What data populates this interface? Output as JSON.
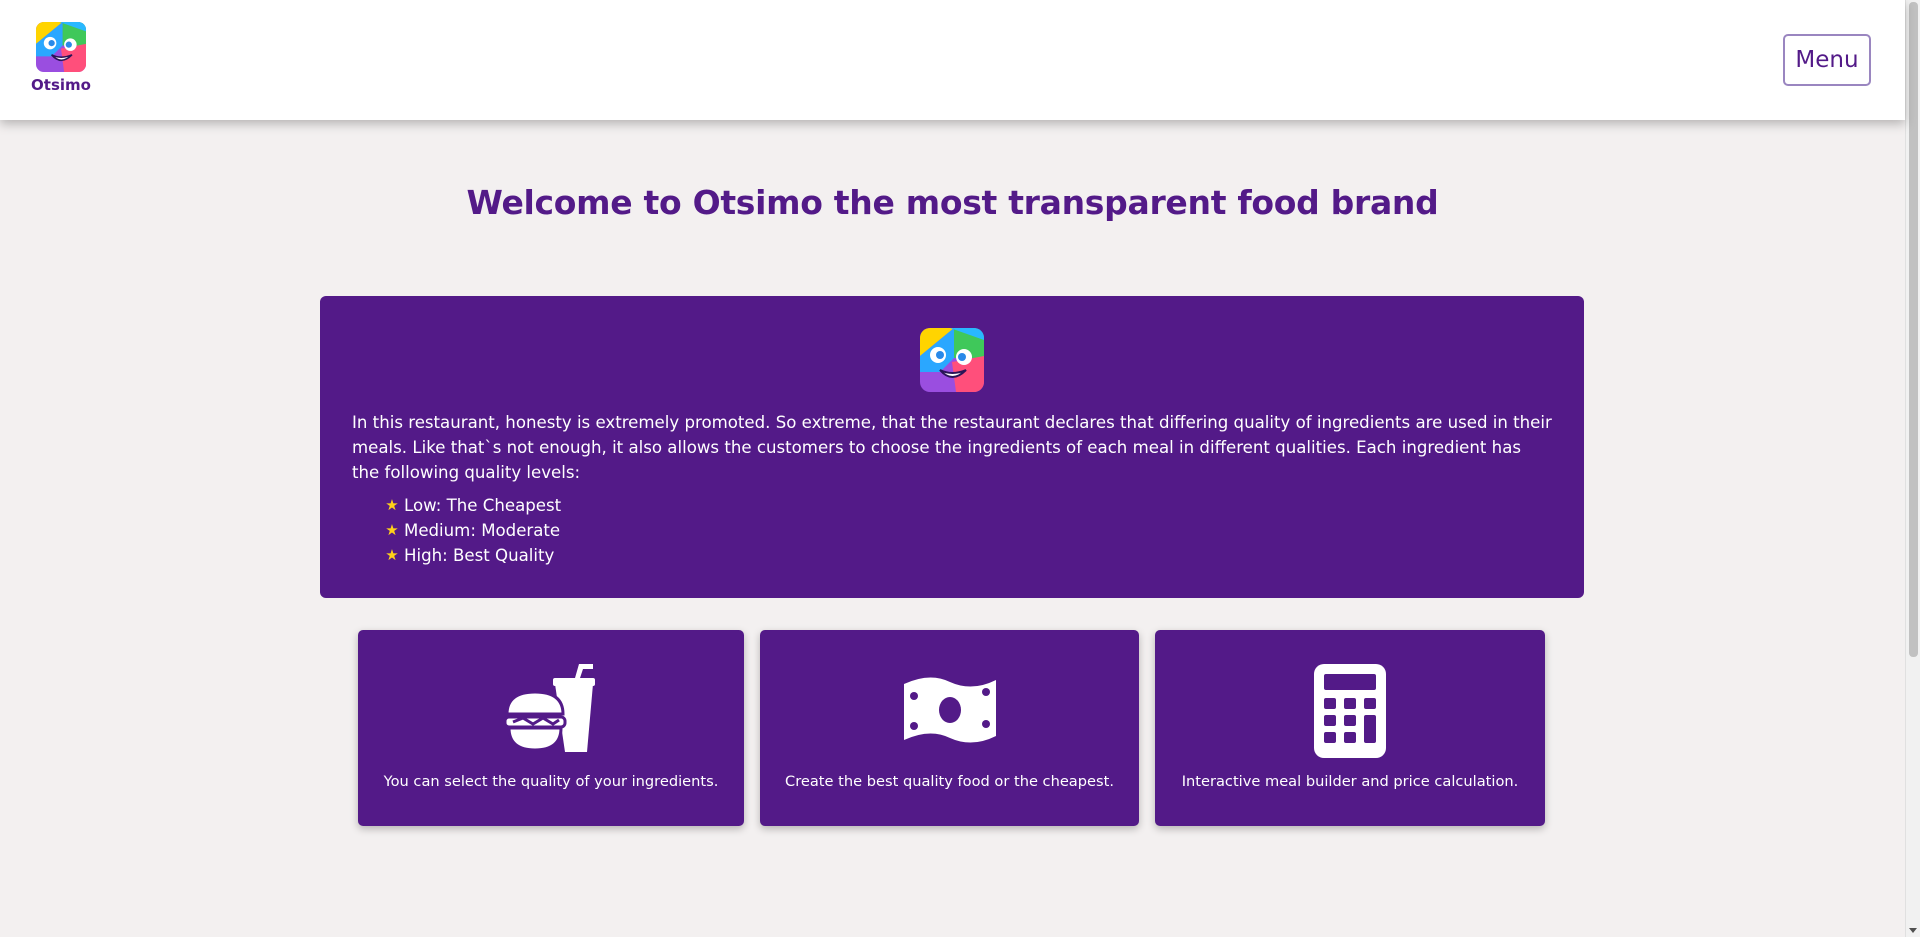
{
  "header": {
    "brand_name": "Otsimo",
    "menu_label": "Menu"
  },
  "main": {
    "title": "Welcome to Otsimo the most transparent food brand",
    "intro": {
      "text": "In this restaurant, honesty is extremely promoted. So extreme, that the restaurant declares that differing quality of ingredients are used in their meals. Like that`s not enough, it also allows the customers to choose the ingredients of each meal in different qualities. Each ingredient has the following quality levels:",
      "levels": [
        "Low: The Cheapest",
        "Medium: Moderate",
        "High: Best Quality"
      ]
    },
    "features": [
      {
        "icon": "burger-soda-icon",
        "text": "You can select the quality of your ingredients."
      },
      {
        "icon": "money-bill-icon",
        "text": "Create the best quality food or the cheapest."
      },
      {
        "icon": "calculator-icon",
        "text": "Interactive meal builder and price calculation."
      }
    ]
  },
  "colors": {
    "brand_purple": "#531a88",
    "background": "#f3f0f0",
    "star": "#ffd11a"
  }
}
